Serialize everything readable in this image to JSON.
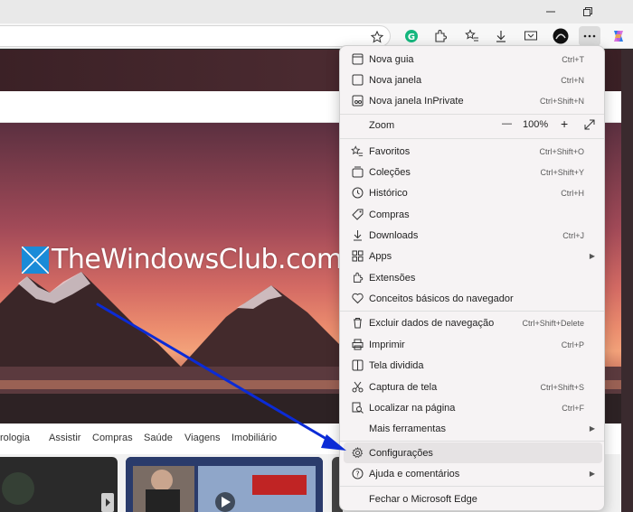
{
  "colors": {
    "accent": "#0a5ad8",
    "arrow": "#0b2bd6",
    "menu_bg": "#f6f3f4"
  },
  "toolbar": {
    "icons": [
      "star-icon",
      "grammarly-icon",
      "extensions-icon",
      "favorites-icon",
      "download-icon",
      "screenshot-icon",
      "profile-icon",
      "more-icon",
      "copilot-icon"
    ]
  },
  "hero": {
    "logo_text": "TheWindowsClub.com"
  },
  "nav": {
    "items": [
      "rologia",
      "Assistir",
      "Compras",
      "Saúde",
      "Viagens",
      "Imobiliário"
    ]
  },
  "menu": {
    "new_tab": {
      "label": "Nova guia",
      "shortcut": "Ctrl+T"
    },
    "new_window": {
      "label": "Nova janela",
      "shortcut": "Ctrl+N"
    },
    "inprivate": {
      "label": "Nova janela InPrivate",
      "shortcut": "Ctrl+Shift+N"
    },
    "zoom": {
      "label": "Zoom",
      "minus": "—",
      "value": "100%",
      "plus": "+"
    },
    "favorites": {
      "label": "Favoritos",
      "shortcut": "Ctrl+Shift+O"
    },
    "collections": {
      "label": "Coleções",
      "shortcut": "Ctrl+Shift+Y"
    },
    "history": {
      "label": "Histórico",
      "shortcut": "Ctrl+H"
    },
    "shopping": {
      "label": "Compras"
    },
    "downloads": {
      "label": "Downloads",
      "shortcut": "Ctrl+J"
    },
    "apps": {
      "label": "Apps"
    },
    "extensions": {
      "label": "Extensões"
    },
    "essentials": {
      "label": "Conceitos básicos do navegador"
    },
    "clear_data": {
      "label": "Excluir dados de navegação",
      "shortcut": "Ctrl+Shift+Delete"
    },
    "print": {
      "label": "Imprimir",
      "shortcut": "Ctrl+P"
    },
    "split": {
      "label": "Tela dividida"
    },
    "capture": {
      "label": "Captura de tela",
      "shortcut": "Ctrl+Shift+S"
    },
    "find": {
      "label": "Localizar na página",
      "shortcut": "Ctrl+F"
    },
    "more_tools": {
      "label": "Mais ferramentas"
    },
    "settings": {
      "label": "Configurações"
    },
    "help": {
      "label": "Ajuda e comentários"
    },
    "close": {
      "label": "Fechar o Microsoft Edge"
    }
  }
}
